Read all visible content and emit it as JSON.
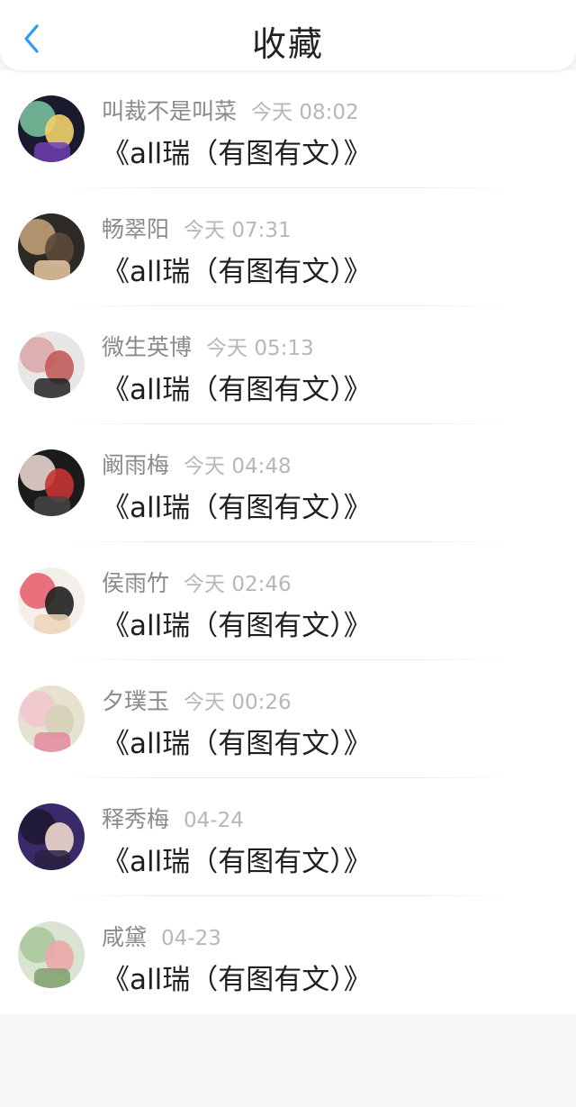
{
  "header": {
    "title": "收藏",
    "accent": "#2f9bf0"
  },
  "items": [
    {
      "name": "叫裁不是叫菜",
      "time": "今天 08:02",
      "title": "《all瑞（有图有文）》",
      "avatar_colors": [
        "#1a1a2e",
        "#7ec8a0",
        "#f2d16b",
        "#6f3fb2"
      ]
    },
    {
      "name": "畅翠阳",
      "time": "今天 07:31",
      "title": "《all瑞（有图有文）》",
      "avatar_colors": [
        "#2d2a26",
        "#c9a57b",
        "#5b4a3a",
        "#e8c9a0"
      ]
    },
    {
      "name": "微生英博",
      "time": "今天 05:13",
      "title": "《all瑞（有图有文）》",
      "avatar_colors": [
        "#e9e6e6",
        "#d9a6a6",
        "#c25b5b",
        "#222222"
      ]
    },
    {
      "name": "阚雨梅",
      "time": "今天 04:48",
      "title": "《all瑞（有图有文）》",
      "avatar_colors": [
        "#1b1b1b",
        "#f1ded6",
        "#c63434",
        "#444444"
      ]
    },
    {
      "name": "侯雨竹",
      "time": "今天 02:46",
      "title": "《all瑞（有图有文）》",
      "avatar_colors": [
        "#f4efe9",
        "#e65b6b",
        "#202020",
        "#ecd3b8"
      ]
    },
    {
      "name": "夕璞玉",
      "time": "今天 00:26",
      "title": "《all瑞（有图有文）》",
      "avatar_colors": [
        "#e6e2cf",
        "#f2c6cf",
        "#d5d0b5",
        "#e58aa0"
      ]
    },
    {
      "name": "释秀梅",
      "time": "04-24",
      "title": "《all瑞（有图有文）》",
      "avatar_colors": [
        "#3a2a6a",
        "#1d1730",
        "#f0d8cc",
        "#2a2040"
      ]
    },
    {
      "name": "咸黛",
      "time": "04-23",
      "title": "《all瑞（有图有文）》",
      "avatar_colors": [
        "#d9e4d2",
        "#a7c79a",
        "#e9a9a9",
        "#7fa06f"
      ]
    }
  ]
}
